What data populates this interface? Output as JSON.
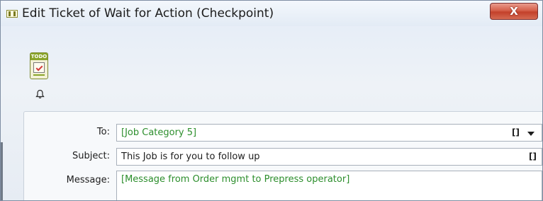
{
  "window": {
    "title": "Edit Ticket of Wait for Action (Checkpoint)",
    "close_label": "X"
  },
  "toolbar": {
    "todo_icon_text": "TODO",
    "todo_icon": "todo-checklist-icon",
    "bell_icon": "bell-icon"
  },
  "form": {
    "to": {
      "label": "To:",
      "value": "[Job Category 5]",
      "brackets": "[]",
      "dropdown_icon": "chevron-down-icon"
    },
    "subject": {
      "label": "Subject:",
      "value": "This Job is for you to follow up",
      "brackets": "[]"
    },
    "message": {
      "label": "Message:",
      "value": "[Message from Order mgmt to Prepress operator]"
    }
  },
  "colors": {
    "variable_text": "#2c8e2c",
    "close_button": "#c3402a"
  }
}
